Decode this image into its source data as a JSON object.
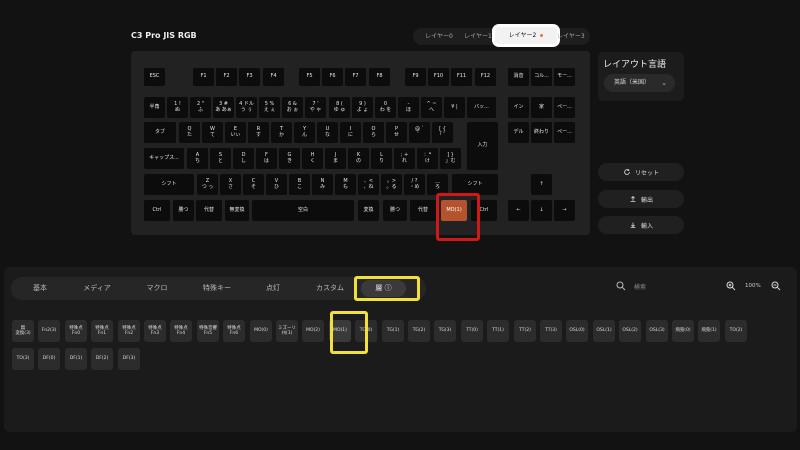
{
  "title": "C3 Pro JIS RGB",
  "layers": [
    {
      "label": "レイヤー0"
    },
    {
      "label": "レイヤー1"
    },
    {
      "label": "レイヤー2"
    },
    {
      "label": "レイヤー3"
    }
  ],
  "keyboard": {
    "row0": [
      "ESC",
      "F1",
      "F2",
      "F3",
      "F4",
      "F5",
      "F6",
      "F7",
      "F8",
      "F9",
      "F10",
      "F11",
      "F12",
      "消音",
      "コル...",
      "モー..."
    ],
    "row1": [
      "半角",
      "1 !\nぬ",
      "2 \"\nふ",
      "3 #\nあ あぁ",
      "4 ドル\nう ぅ",
      "5 %\nえ ぇ",
      "6 &\nお ぉ",
      "7 '\nや ゃ",
      "8 (\nゆ ゅ",
      "9 )\nよ ょ",
      "0\nわ を",
      "-\nほ",
      "^ ~\nへ",
      "¥ |",
      "バッ...",
      "イン",
      "家",
      "ペー..."
    ],
    "row2": [
      "タブ",
      "Q\nた",
      "W\nて",
      "E\nいぃ",
      "R\nす",
      "T\nか",
      "Y\nん",
      "U\nな",
      "I\nに",
      "O\nら",
      "P\nせ",
      "@ `\n゛",
      "[ {\n「 ゜",
      "デル",
      "終わり",
      "ペー..."
    ],
    "row2enter": "入力",
    "row3": [
      "キャップス...",
      "A\nち",
      "S\nと",
      "D\nし",
      "F\nは",
      "G\nき",
      "H\nく",
      "J\nま",
      "K\nの",
      "L\nり",
      "; +\nれ",
      "：*\nけ",
      "] }\n」む"
    ],
    "row4": [
      "シフト",
      "Z\nつ っ",
      "X\nさ",
      "C\nそ",
      "V\nひ",
      "B\nこ",
      "N\nみ",
      "M\nも",
      "、<\n、ね",
      "。>\n。る",
      "/ ?\n・め",
      "＿\nろ",
      "シフト",
      "↑"
    ],
    "row5": [
      "Ctrl",
      "勝つ",
      "代替",
      "無変換",
      "空白",
      "変換",
      "勝つ",
      "代替",
      "MO(1)",
      "Ctrl",
      "←",
      "↓",
      "→"
    ]
  },
  "side": {
    "layout_lang_title": "レイアウト言語",
    "layout_lang_value": "英語（米国）",
    "reset": "リセット",
    "export": "輸出",
    "import": "輸入"
  },
  "categories": [
    "基本",
    "メディア",
    "マクロ",
    "特殊キー",
    "点灯",
    "カスタム",
    "層 ⓘ"
  ],
  "search_placeholder": "検索",
  "zoom": "100%",
  "layer_keys_row1": [
    "無\n変換(3)",
    "Fn2(3)",
    "特殊点\nFn0",
    "特殊点\nFn1",
    "特殊点\nFn2",
    "特殊点\nFn3",
    "特殊点\nFn4",
    "特殊音響\nFn5",
    "特殊点\nFn6",
    "MO(0)",
    "ミズーリ\n州(1)",
    "MO(2)",
    "MO(1)",
    "TG(0)",
    "TG(1)",
    "TG(2)",
    "TG(3)",
    "TT(0)",
    "TT(1)",
    "TT(2)",
    "TT(3)",
    "OSL(0)",
    "OSL(1)",
    "OSL(2)",
    "OSL(3)",
    "飛兎(0)",
    "飛兎(1)",
    "TO(2)"
  ],
  "layer_keys_row2": [
    "TO(3)",
    "DF(0)",
    "DF(1)",
    "DF(2)",
    "DF(3)"
  ]
}
